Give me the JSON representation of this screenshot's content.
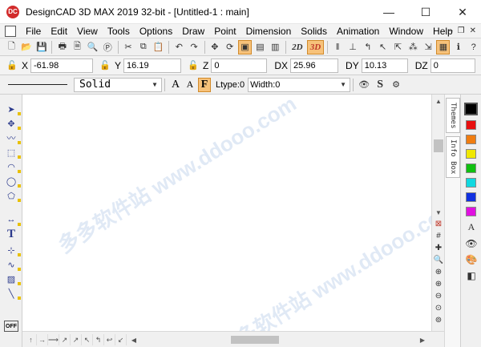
{
  "window": {
    "title": "DesignCAD 3D MAX 2019 32-bit - [Untitled-1 : main]",
    "app_icon_text": "DC",
    "minimize": "—",
    "maximize": "☐",
    "close": "✕"
  },
  "menu": {
    "items": [
      "File",
      "Edit",
      "View",
      "Tools",
      "Options",
      "Draw",
      "Point",
      "Dimension",
      "Solids",
      "Animation",
      "Window",
      "Help"
    ],
    "mdi_minimize": "–",
    "mdi_restore": "❐",
    "mdi_close": "✕"
  },
  "toolbar": {
    "btn_2d": "2D",
    "btn_3d": "3D"
  },
  "coords": {
    "x_label": "X",
    "x_value": "-61.98",
    "y_label": "Y",
    "y_value": "16.19",
    "z_label": "Z",
    "z_value": "0",
    "dx_label": "DX",
    "dx_value": "25.96",
    "dy_label": "DY",
    "dy_value": "10.13",
    "dz_label": "DZ",
    "dz_value": "0"
  },
  "linestyle": {
    "style": "Solid",
    "ltype_label": "Ltype:0",
    "width_label": "Width:0",
    "font_a_large": "A",
    "font_a_small": "A",
    "font_f": "F",
    "s_button": "S"
  },
  "sidetabs": {
    "themes": "Themes",
    "info_box": "Info Box"
  },
  "lefttools": {
    "off_label": "OFF",
    "text_tool": "T"
  },
  "palette": {
    "colors": [
      "#000000",
      "#e81010",
      "#f07d10",
      "#f0e800",
      "#10c010",
      "#10d8e0",
      "#1030e0",
      "#e010e0"
    ],
    "selected": "#000000",
    "text_tool": "A"
  },
  "watermark": "多多软件站 www.ddooo.com"
}
